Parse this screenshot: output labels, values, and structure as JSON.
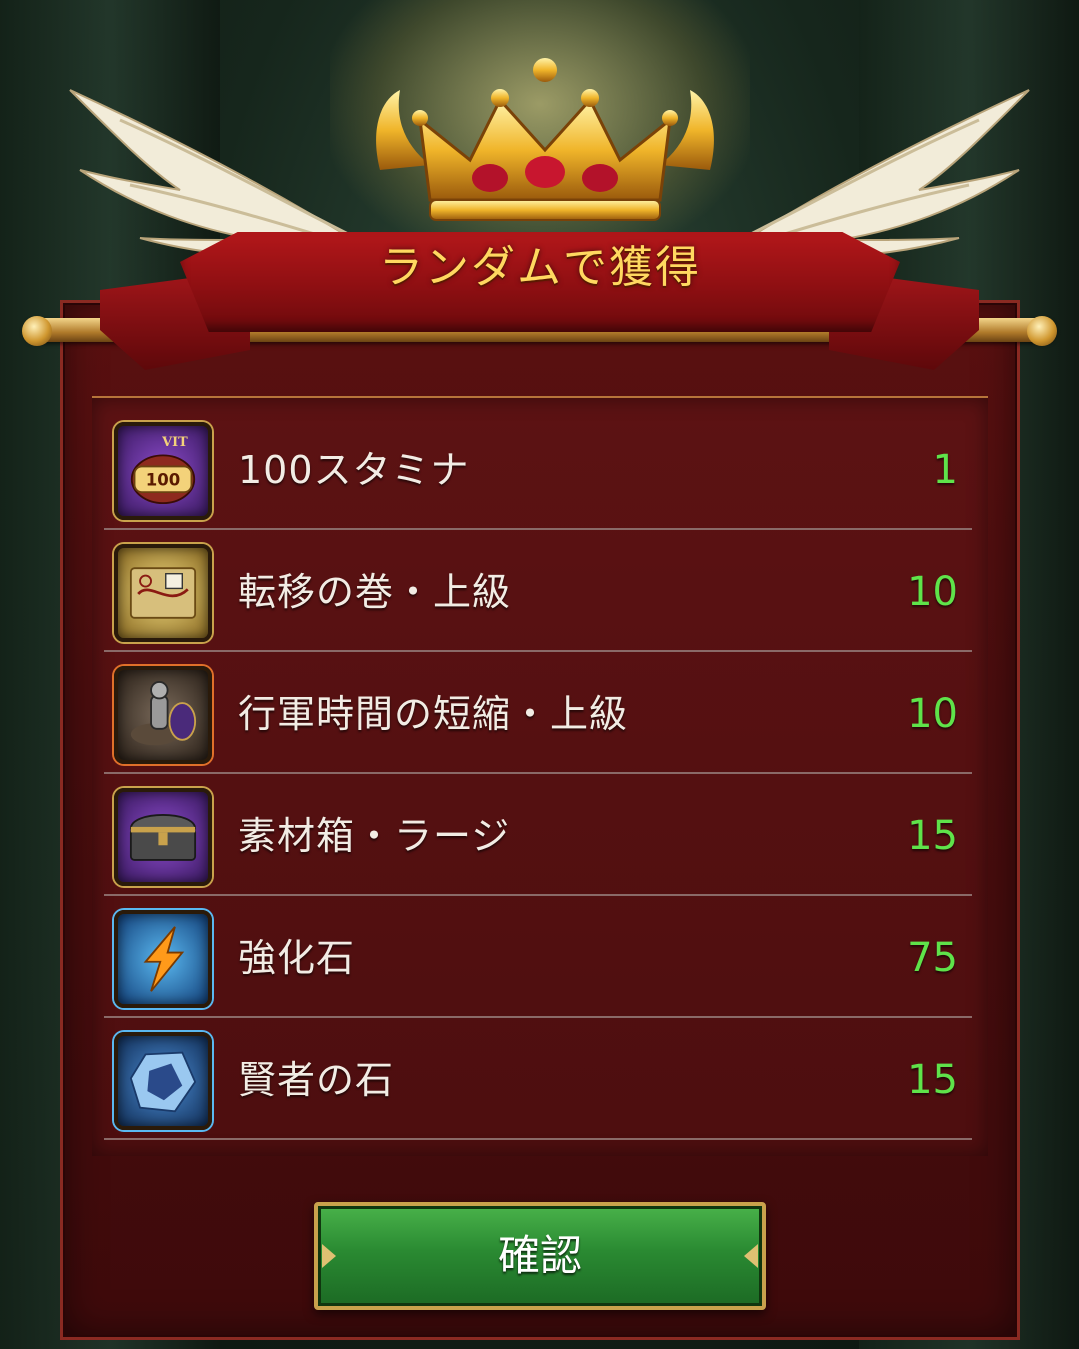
{
  "dialog": {
    "title": "ランダムで獲得",
    "confirm_label": "確認"
  },
  "items": [
    {
      "name": "100スタミナ",
      "count": "1",
      "icon": "stamina-icon",
      "icon_badge": "100",
      "icon_tag": "VIT"
    },
    {
      "name": "転移の巻・上級",
      "count": "10",
      "icon": "teleport-scroll-icon"
    },
    {
      "name": "行軍時間の短縮・上級",
      "count": "10",
      "icon": "march-speedup-icon"
    },
    {
      "name": "素材箱・ラージ",
      "count": "15",
      "icon": "material-chest-icon"
    },
    {
      "name": "強化石",
      "count": "75",
      "icon": "enhance-stone-icon"
    },
    {
      "name": "賢者の石",
      "count": "15",
      "icon": "sages-stone-icon"
    }
  ],
  "colors": {
    "count_green": "#5fe34a",
    "title_gold": "#ffd860",
    "panel_red": "#4a0d0e",
    "button_green": "#2a8a32"
  }
}
